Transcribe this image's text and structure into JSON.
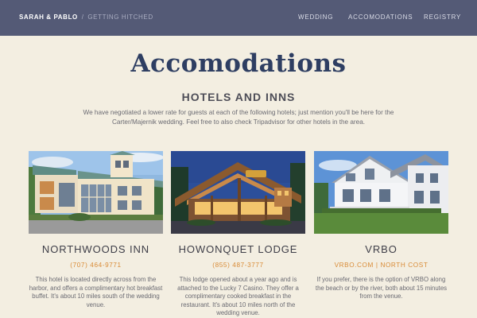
{
  "brand": {
    "names": "SARAH & PABLO",
    "separator": "/",
    "tagline": "GETTING HITCHED"
  },
  "nav": {
    "links": [
      {
        "label": "WEDDING"
      },
      {
        "label": "ACCOMODATIONS"
      },
      {
        "label": "REGISTRY"
      }
    ]
  },
  "main": {
    "title": "Accomodations",
    "subtitle": "HOTELS AND INNS",
    "intro": "We have negotiated a lower rate for guests at each of the following hotels; just mention you'll be here for the Carter/Majernik wedding. Feel free to also check Tripadvisor for other hotels in the area."
  },
  "cards": [
    {
      "name": "NORTHWOODS INN",
      "contact": "(707) 464-9771",
      "description": "This hotel is located directly across from the harbor, and offers a complimentary hot breakfast buffet. It's about 10 miles south of the wedding venue."
    },
    {
      "name": "HOWONQUET LODGE",
      "contact": "(855) 487-3777",
      "description": "This lodge opened about a year ago and is attached to the Lucky 7 Casino. They offer a complimentary cooked breakfast in the restaurant. It's about 10 miles north of the wedding venue."
    },
    {
      "name": "VRBO",
      "contact_link": "VRBO.COM",
      "contact_sep": "|",
      "contact_link2": "NORTH COST",
      "description": "If you prefer, there is the option of VRBO along the beach or by the river, both about 15 minutes from the venue."
    }
  ],
  "colors": {
    "navbar": "#545a76",
    "background": "#f3eee1",
    "title": "#2e3e62",
    "accent": "#d98b36"
  }
}
